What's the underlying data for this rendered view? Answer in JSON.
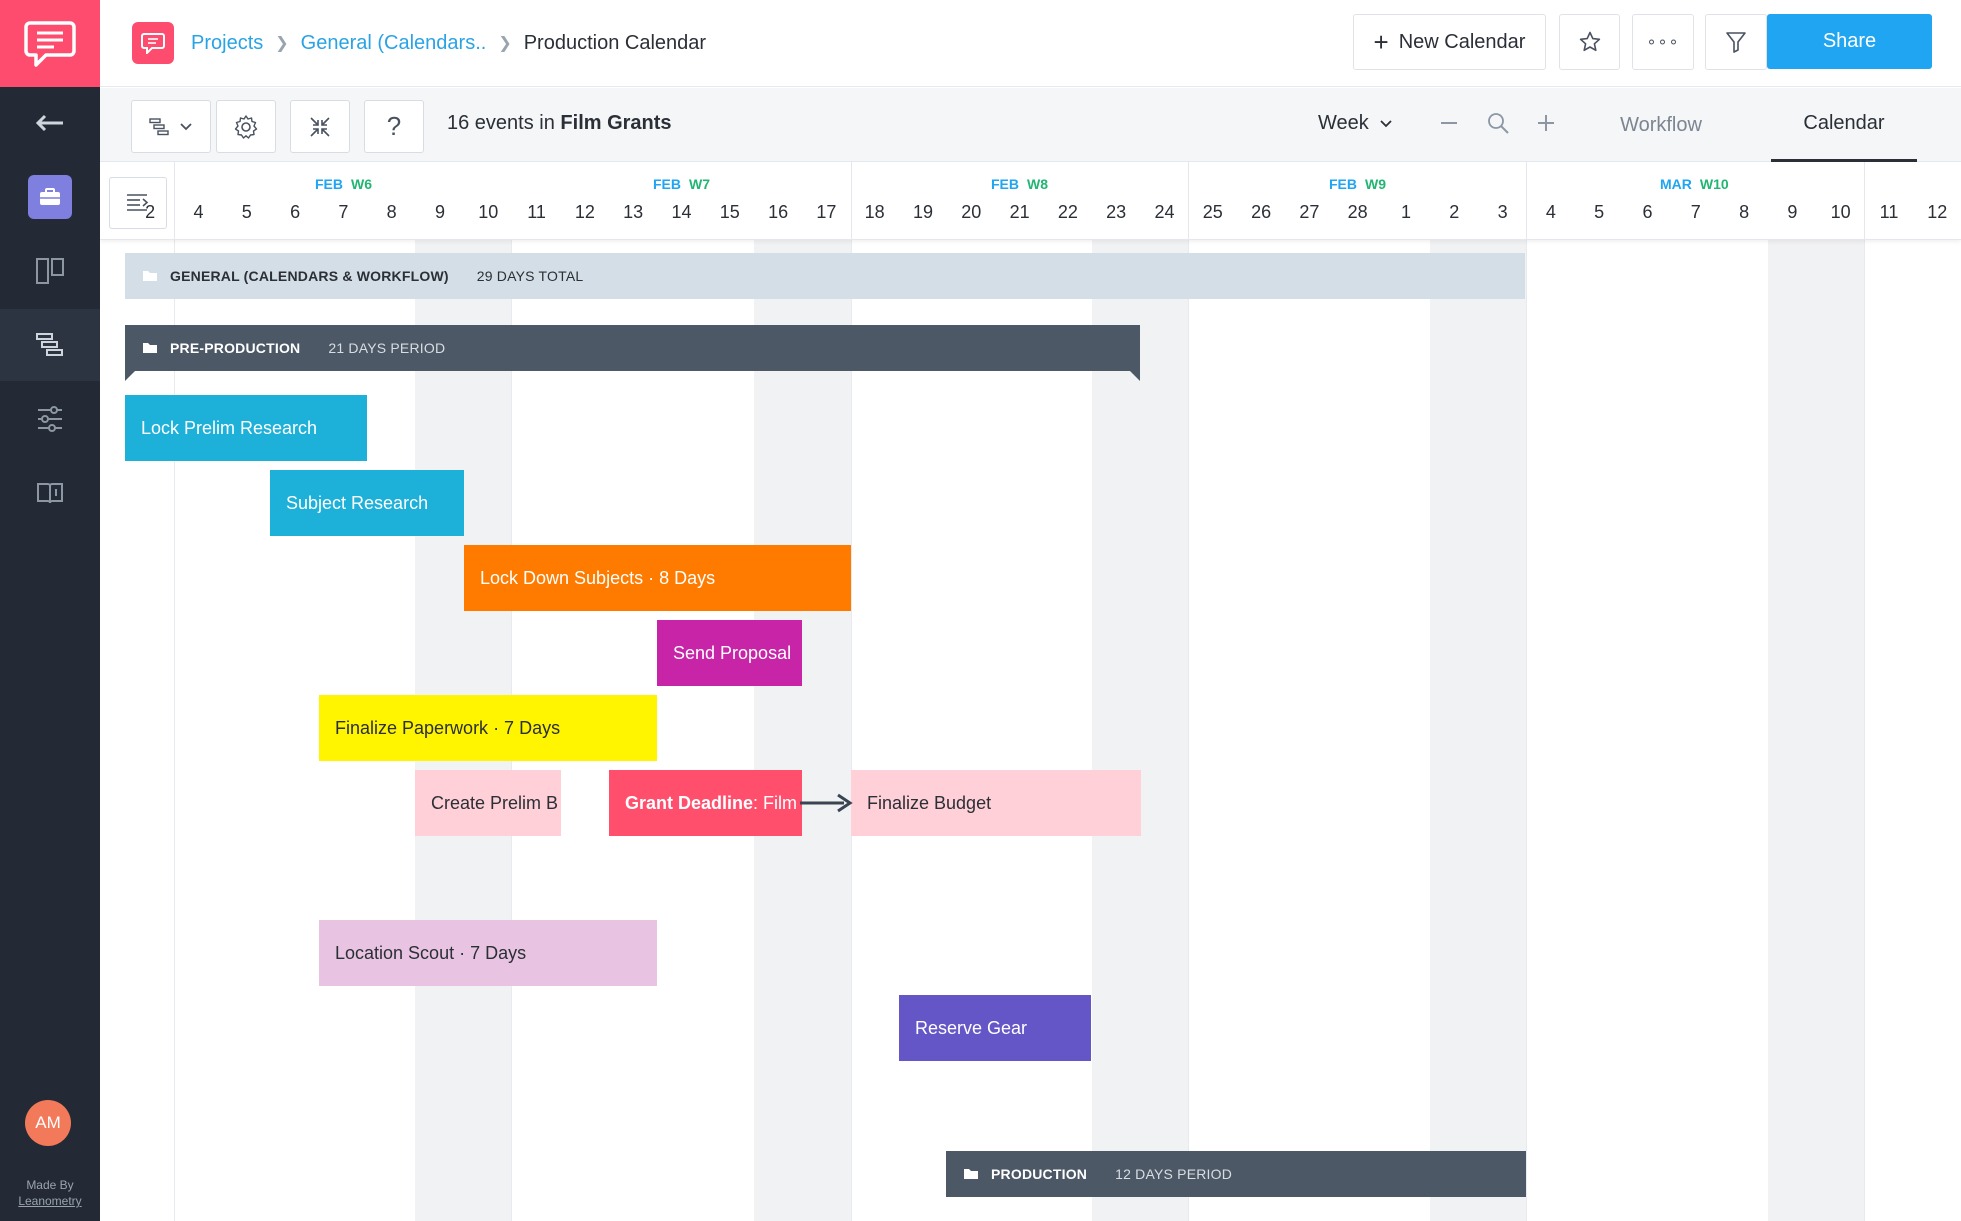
{
  "colors": {
    "brand": "#fd4c6d",
    "link": "#1fa5f1",
    "week_number": "#22b573",
    "sidebar_bg": "#232a35",
    "share_button": "#1fa5f1"
  },
  "sidebar": {
    "items": [
      {
        "icon": "back-arrow-icon"
      },
      {
        "icon": "briefcase-icon",
        "active": false
      },
      {
        "icon": "board-icon"
      },
      {
        "icon": "timeline-icon",
        "active": true
      },
      {
        "icon": "sliders-icon"
      },
      {
        "icon": "book-icon"
      }
    ],
    "avatar_initials": "AM",
    "made_by": "Made By",
    "made_by_brand": "Leanometry"
  },
  "breadcrumb": {
    "projects": "Projects",
    "general": "General (Calendars..",
    "current": "Production Calendar"
  },
  "topbar": {
    "new_calendar": "New Calendar",
    "more_glyph": "∘∘∘",
    "share": "Share"
  },
  "toolbar": {
    "help_glyph": "?",
    "event_count_prefix": "16 events in",
    "event_count_project": "Film Grants",
    "scale": "Week",
    "tabs": [
      "Workflow",
      "Calendar"
    ],
    "active_tab": "Calendar"
  },
  "calendar": {
    "weeks": [
      {
        "month": "FEB",
        "week": "W6"
      },
      {
        "month": "FEB",
        "week": "W7"
      },
      {
        "month": "FEB",
        "week": "W8"
      },
      {
        "month": "FEB",
        "week": "W9"
      },
      {
        "month": "MAR",
        "week": "W10"
      }
    ],
    "days": [
      "2",
      "4",
      "5",
      "6",
      "7",
      "8",
      "9",
      "10",
      "11",
      "12",
      "13",
      "14",
      "15",
      "16",
      "17",
      "18",
      "19",
      "20",
      "21",
      "22",
      "23",
      "24",
      "25",
      "26",
      "27",
      "28",
      "1",
      "2",
      "3",
      "4",
      "5",
      "6",
      "7",
      "8",
      "9",
      "10",
      "11",
      "12"
    ],
    "phases": {
      "general": {
        "name": "GENERAL (CALENDARS & WORKFLOW)",
        "meta": "29 DAYS TOTAL"
      },
      "preproduction": {
        "name": "PRE-PRODUCTION",
        "meta": "21 DAYS PERIOD"
      },
      "production": {
        "name": "PRODUCTION",
        "meta": "12 DAYS PERIOD"
      }
    },
    "events": {
      "lock_prelim": "Lock Prelim Research",
      "subject_research": "Subject Research",
      "lock_subjects": "Lock Down Subjects · 8 Days",
      "send_proposal": "Send Proposal",
      "finalize_paperwork": "Finalize Paperwork · 7 Days",
      "create_prelim": "Create Prelim B",
      "grant_deadline_bold": "Grant Deadline",
      "grant_deadline_rest": ": Film",
      "finalize_budget": "Finalize Budget",
      "location_scout": "Location Scout · 7 Days",
      "reserve_gear": "Reserve Gear"
    }
  }
}
